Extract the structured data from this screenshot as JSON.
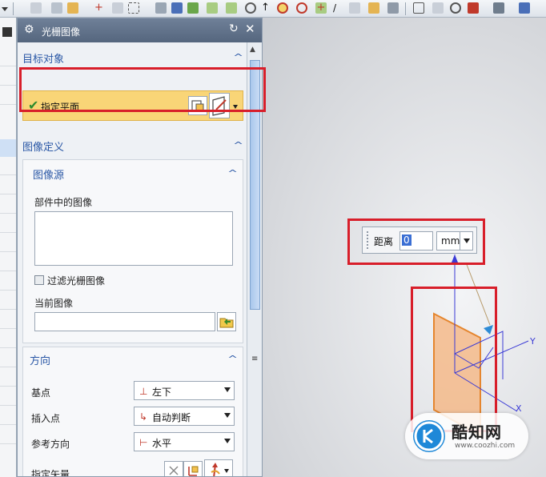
{
  "dialog": {
    "title": "光栅图像",
    "sections": {
      "target": {
        "title": "目标对象",
        "specify_plane": "指定平面"
      },
      "image_def": {
        "title": "图像定义",
        "source": {
          "title": "图像源",
          "images_in_part_label": "部件中的图像",
          "filter_checkbox_label": "过滤光栅图像",
          "current_image_label": "当前图像",
          "current_image_value": ""
        }
      },
      "orientation": {
        "title": "方向",
        "base_point": {
          "label": "基点",
          "value": "左下"
        },
        "insert_point": {
          "label": "插入点",
          "value": "自动判断"
        },
        "reference_direction": {
          "label": "参考方向",
          "value": "水平"
        },
        "specify_vector": {
          "label": "指定矢量"
        }
      }
    }
  },
  "viewport": {
    "distance": {
      "label": "距离",
      "value": "0",
      "unit": "mm"
    },
    "axes": {
      "x": "X",
      "y": "Y"
    }
  },
  "watermark": {
    "brand": "酷知网",
    "url": "www.coozhi.com"
  },
  "colors": {
    "title_bar": "#5e6f88",
    "section_title": "#2b58a6",
    "highlight_frame": "#d81e2a",
    "plane_fill": "#f5b37a",
    "plane_edge": "#e5862f",
    "csys_lines": "#3b3bd6"
  }
}
